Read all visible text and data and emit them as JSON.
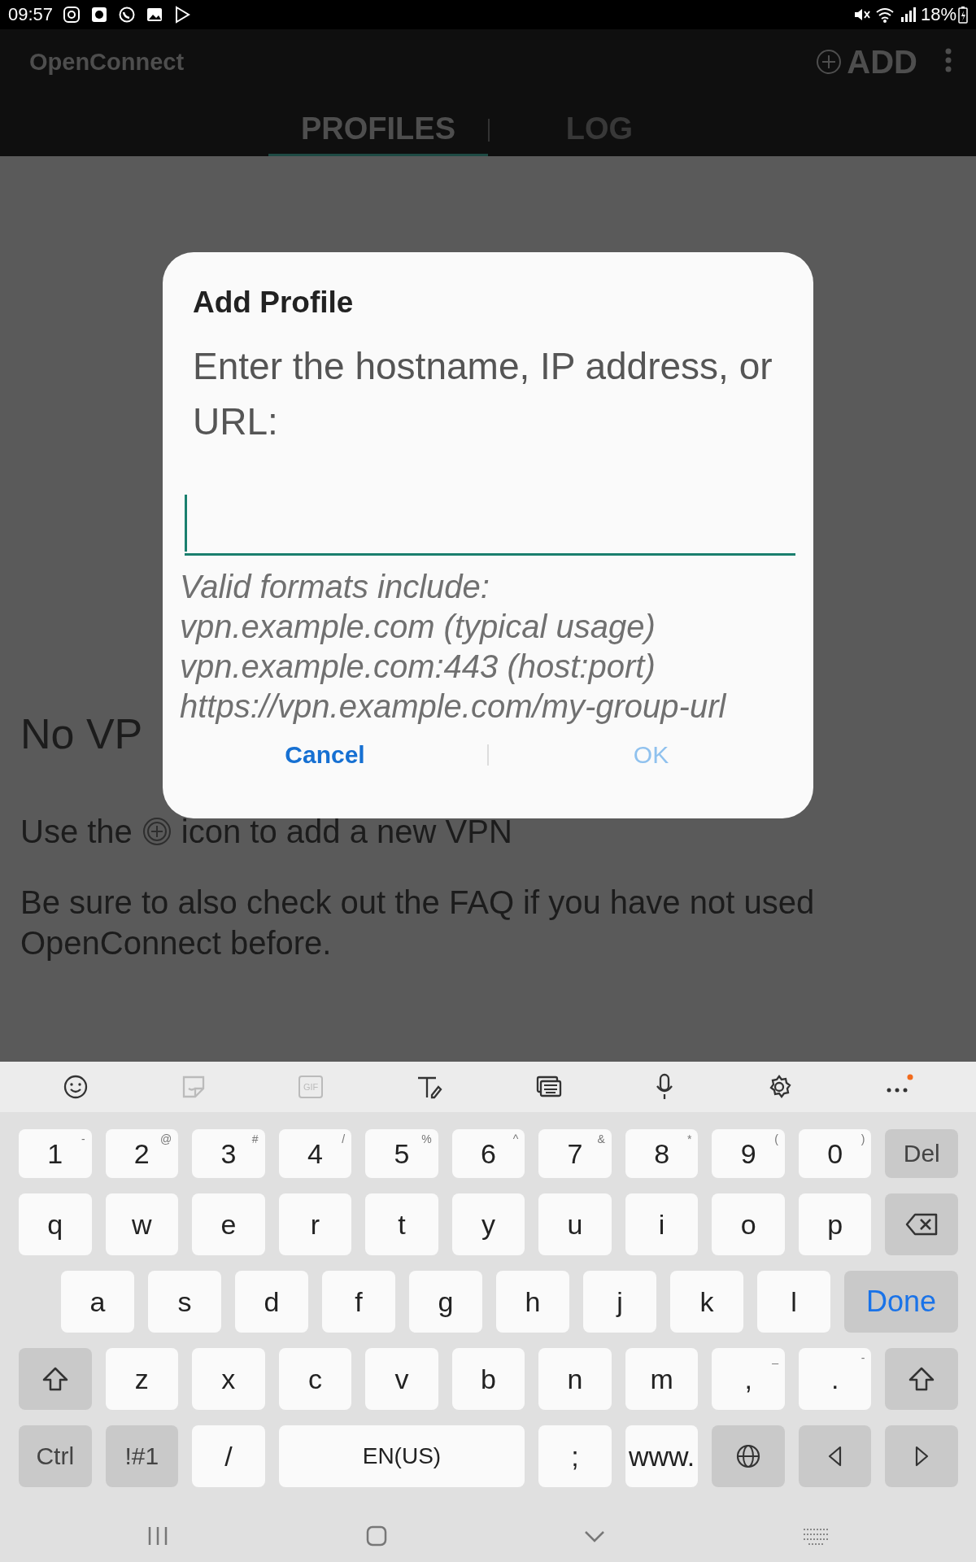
{
  "status_bar": {
    "time": "09:57",
    "battery": "18%"
  },
  "app_bar": {
    "title": "OpenConnect",
    "add_label": "ADD"
  },
  "tabs": [
    {
      "label": "PROFILES",
      "selected": true
    },
    {
      "label": "LOG",
      "selected": false
    }
  ],
  "empty_state": {
    "heading": "No VP",
    "hint_before": "Use the",
    "hint_after": "icon to add a new VPN",
    "paragraph": "Be sure to also check out the FAQ if you have not used OpenConnect before."
  },
  "dialog": {
    "title": "Add Profile",
    "message": "Enter the hostname, IP address, or URL:",
    "hint_lines": [
      "Valid formats include:",
      "vpn.example.com (typical usage)",
      "vpn.example.com:443 (host:port)",
      "https://vpn.example.com/my-group-url"
    ],
    "buttons": [
      {
        "label": "Cancel",
        "disabled": false
      },
      {
        "label": "OK",
        "disabled": true
      }
    ]
  },
  "keyboard": {
    "gif_label": "GIF",
    "rows": [
      {
        "keys": [
          {
            "kind": "char",
            "label": "1",
            "sup": "-"
          },
          {
            "kind": "char",
            "label": "2",
            "sup": "@"
          },
          {
            "kind": "char",
            "label": "3",
            "sup": "#"
          },
          {
            "kind": "char",
            "label": "4",
            "sup": "/"
          },
          {
            "kind": "char",
            "label": "5",
            "sup": "%"
          },
          {
            "kind": "char",
            "label": "6",
            "sup": "^"
          },
          {
            "kind": "char",
            "label": "7",
            "sup": "&"
          },
          {
            "kind": "char",
            "label": "8",
            "sup": "*"
          },
          {
            "kind": "char",
            "label": "9",
            "sup": "("
          },
          {
            "kind": "char",
            "label": "0",
            "sup": ")"
          },
          {
            "kind": "mod",
            "label": "Del"
          }
        ]
      },
      {
        "keys": [
          {
            "kind": "char",
            "label": "q"
          },
          {
            "kind": "char",
            "label": "w"
          },
          {
            "kind": "char",
            "label": "e"
          },
          {
            "kind": "char",
            "label": "r"
          },
          {
            "kind": "char",
            "label": "t"
          },
          {
            "kind": "char",
            "label": "y"
          },
          {
            "kind": "char",
            "label": "u"
          },
          {
            "kind": "char",
            "label": "i"
          },
          {
            "kind": "char",
            "label": "o"
          },
          {
            "kind": "char",
            "label": "p"
          },
          {
            "kind": "backspace"
          }
        ]
      },
      {
        "keys": [
          {
            "kind": "char",
            "label": "a"
          },
          {
            "kind": "char",
            "label": "s"
          },
          {
            "kind": "char",
            "label": "d"
          },
          {
            "kind": "char",
            "label": "f"
          },
          {
            "kind": "char",
            "label": "g"
          },
          {
            "kind": "char",
            "label": "h"
          },
          {
            "kind": "char",
            "label": "j"
          },
          {
            "kind": "char",
            "label": "k"
          },
          {
            "kind": "char",
            "label": "l"
          },
          {
            "kind": "action",
            "label": "Done"
          }
        ]
      },
      {
        "keys": [
          {
            "kind": "shift"
          },
          {
            "kind": "char",
            "label": "z"
          },
          {
            "kind": "char",
            "label": "x"
          },
          {
            "kind": "char",
            "label": "c"
          },
          {
            "kind": "char",
            "label": "v"
          },
          {
            "kind": "char",
            "label": "b"
          },
          {
            "kind": "char",
            "label": "n"
          },
          {
            "kind": "char",
            "label": "m"
          },
          {
            "kind": "char",
            "label": ",",
            "sup": "_"
          },
          {
            "kind": "char",
            "label": ".",
            "sup": "-"
          },
          {
            "kind": "shift"
          }
        ]
      },
      {
        "keys": [
          {
            "kind": "mod",
            "label": "Ctrl"
          },
          {
            "kind": "mod",
            "label": "!#1"
          },
          {
            "kind": "char",
            "label": "/"
          },
          {
            "kind": "space",
            "label": "EN(US)"
          },
          {
            "kind": "char",
            "label": ";"
          },
          {
            "kind": "char",
            "label": "www."
          },
          {
            "kind": "globe"
          },
          {
            "kind": "arrow_left"
          },
          {
            "kind": "arrow_right"
          }
        ]
      }
    ]
  }
}
